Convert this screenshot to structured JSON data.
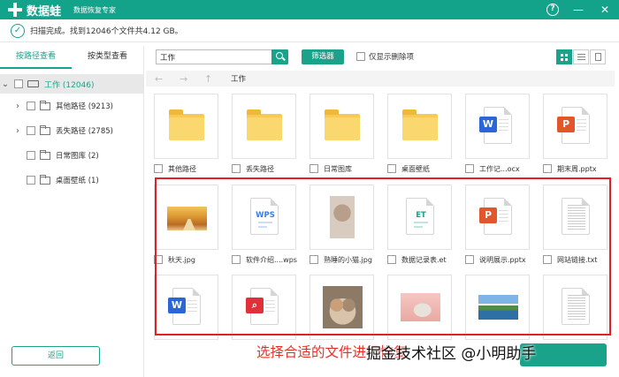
{
  "app": {
    "name": "数据蛙",
    "subtitle": "数据恢复专家"
  },
  "window_controls": {
    "help": "?",
    "minimize": "—",
    "close": "✕"
  },
  "status": {
    "text": "扫描完成。找到12046个文件共4.12 GB。"
  },
  "sidebar": {
    "tabs": [
      {
        "label": "按路径查看",
        "active": true
      },
      {
        "label": "按类型查看",
        "active": false
      }
    ],
    "root": {
      "label": "工作 (12046)"
    },
    "items": [
      {
        "label": "其他路径 (9213)",
        "expandable": true
      },
      {
        "label": "丢失路径 (2785)",
        "expandable": true
      },
      {
        "label": "日常图库 (2)",
        "expandable": false
      },
      {
        "label": "桌面壁纸 (1)",
        "expandable": false
      }
    ],
    "back_button": "返回"
  },
  "toolbar": {
    "search_value": "工作",
    "filter_button": "筛选器",
    "only_deleted_label": "仅显示删除项",
    "view_modes": [
      "grid",
      "list",
      "detail"
    ],
    "active_view": "grid"
  },
  "nav": {
    "back": "←",
    "forward": "→",
    "up": "↑",
    "path": "工作"
  },
  "files": [
    {
      "name": "其他路径",
      "kind": "folder"
    },
    {
      "name": "丢失路径",
      "kind": "folder"
    },
    {
      "name": "日常图库",
      "kind": "folder"
    },
    {
      "name": "桌面壁纸",
      "kind": "folder"
    },
    {
      "name": "工作记...ocx",
      "kind": "word"
    },
    {
      "name": "期末周.pptx",
      "kind": "ppt"
    },
    {
      "name": "秋天.jpg",
      "kind": "img-autumn"
    },
    {
      "name": "软件介绍....wps",
      "kind": "wps"
    },
    {
      "name": "熟睡的小猫.jpg",
      "kind": "img-kitten"
    },
    {
      "name": "数据记录表.et",
      "kind": "et"
    },
    {
      "name": "说明展示.pptx",
      "kind": "ppt"
    },
    {
      "name": "网站链接.txt",
      "kind": "txt"
    },
    {
      "name": "",
      "kind": "word"
    },
    {
      "name": "",
      "kind": "pdf"
    },
    {
      "name": "",
      "kind": "img-cats"
    },
    {
      "name": "",
      "kind": "img-rabbit"
    },
    {
      "name": "",
      "kind": "img-lake"
    },
    {
      "name": "",
      "kind": "txt"
    }
  ],
  "badges": {
    "word": "W",
    "ppt": "P",
    "wps": "WPS",
    "et": "ET"
  },
  "bottom": {
    "note": "选择合适的文件进行恢复",
    "watermark": "掘金技术社区 @小明助手"
  },
  "colors": {
    "accent": "#1aa38a",
    "highlight": "#e41e25",
    "note": "#e23028"
  }
}
